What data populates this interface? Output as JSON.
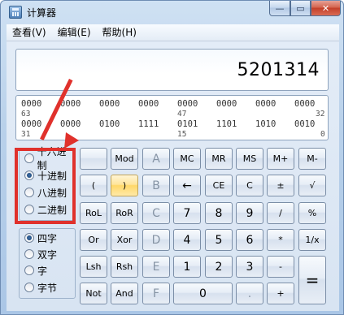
{
  "window": {
    "title": "计算器",
    "minimize_glyph": "—",
    "maximize_glyph": "▭",
    "close_glyph": "✕"
  },
  "menu": {
    "items": [
      "查看(V)",
      "编辑(E)",
      "帮助(H)"
    ]
  },
  "display": {
    "value": "5201314"
  },
  "bits": {
    "row1": [
      "0000",
      "0000",
      "0000",
      "0000",
      "0000",
      "0000",
      "0000",
      "0000"
    ],
    "row1_idx": [
      "63",
      "47",
      "32"
    ],
    "row2": [
      "0000",
      "0000",
      "0100",
      "1111",
      "0101",
      "1101",
      "1010",
      "0010"
    ],
    "row2_idx": [
      "31",
      "15",
      "0"
    ]
  },
  "base_group": {
    "options": [
      "十六进制",
      "十进制",
      "八进制",
      "二进制"
    ],
    "selected": "十进制"
  },
  "word_group": {
    "options": [
      "四字",
      "双字",
      "字",
      "字节"
    ],
    "selected": "四字"
  },
  "keys": {
    "r1": [
      "",
      "Mod",
      "A",
      "MC",
      "MR",
      "MS",
      "M+",
      "M-"
    ],
    "r2": [
      "(",
      ")",
      "B",
      "←",
      "CE",
      "C",
      "±",
      "√"
    ],
    "r3": [
      "RoL",
      "RoR",
      "C",
      "7",
      "8",
      "9",
      "/",
      "%"
    ],
    "r4": [
      "Or",
      "Xor",
      "D",
      "4",
      "5",
      "6",
      "*",
      "1/x"
    ],
    "r5": [
      "Lsh",
      "Rsh",
      "E",
      "1",
      "2",
      "3",
      "-",
      "="
    ],
    "r6": [
      "Not",
      "And",
      "F",
      "0",
      ".",
      "+"
    ]
  },
  "colors": {
    "annotation": "#e0312c",
    "highlight_key": "#ffd868"
  },
  "icons": {
    "app": "calculator-icon"
  }
}
